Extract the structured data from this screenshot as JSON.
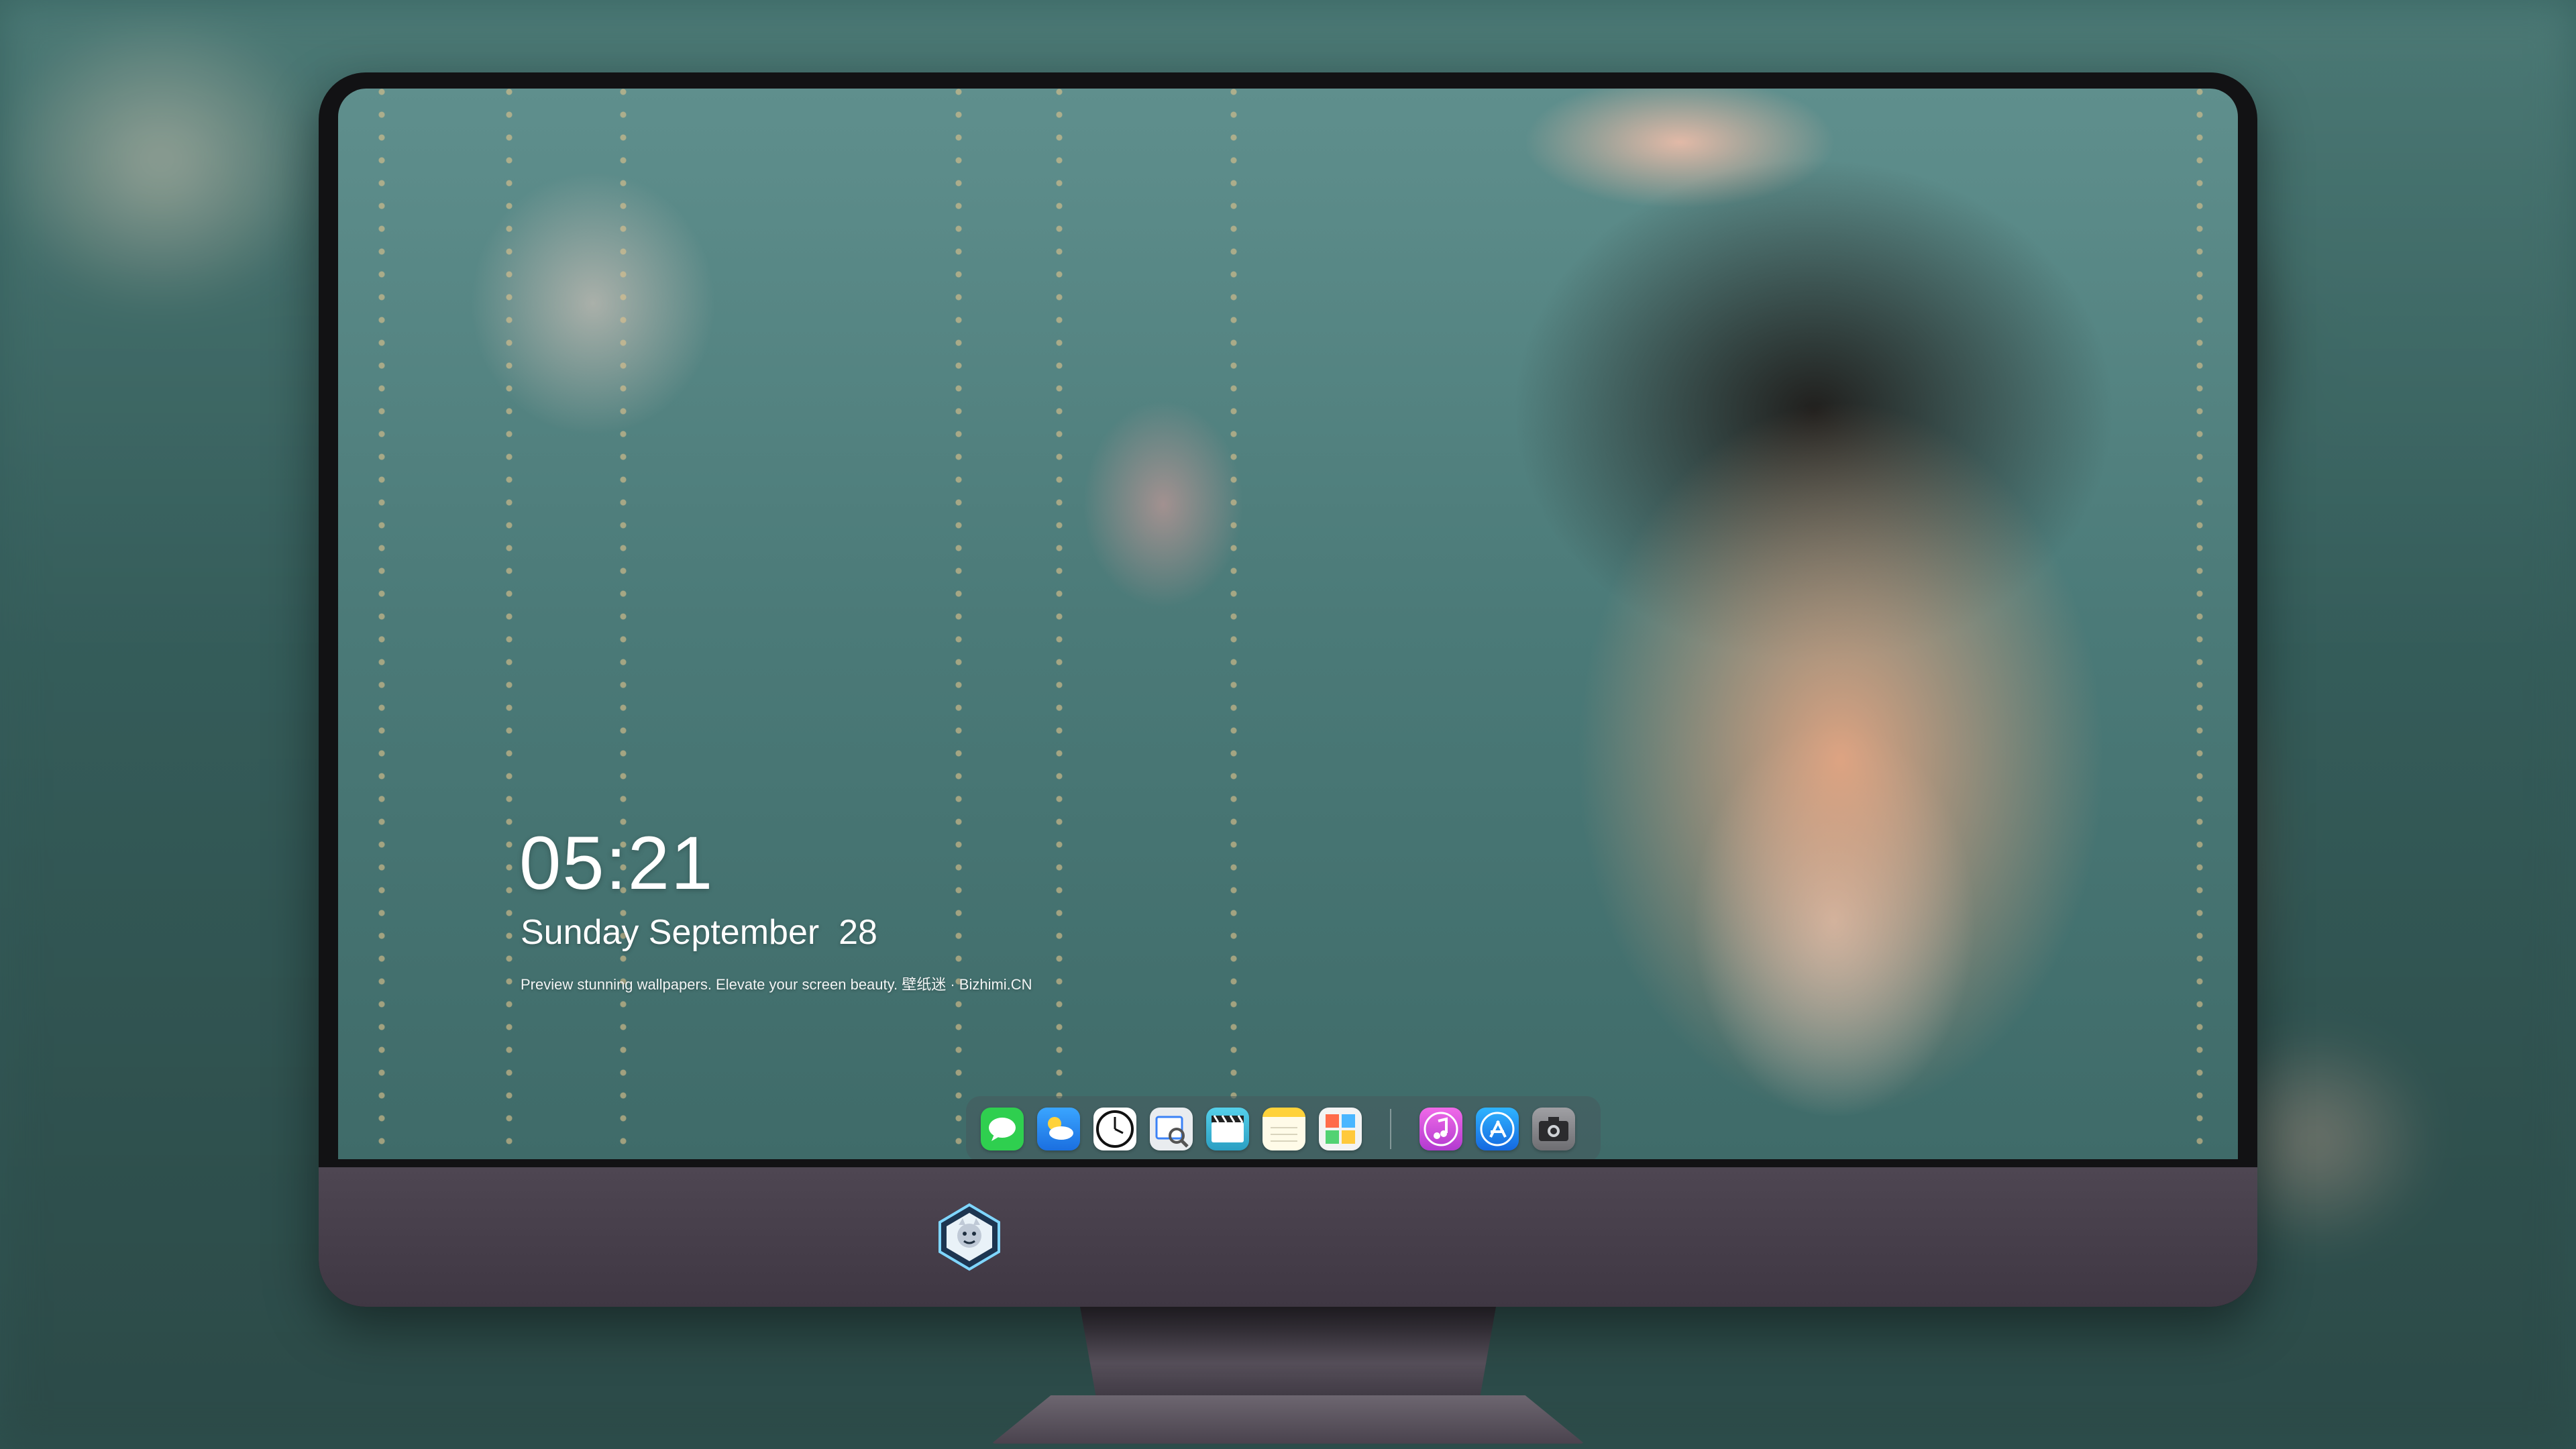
{
  "lock_screen": {
    "time": "05:21",
    "date": "Sunday September  28",
    "tagline": "Preview stunning wallpapers. Elevate your screen beauty. 壁纸迷 · Bizhimi.CN"
  },
  "dock": {
    "apps": [
      {
        "name": "messages-icon",
        "color": "#2fcf4f"
      },
      {
        "name": "weather-icon",
        "color": "#2a8cf0"
      },
      {
        "name": "clock-icon",
        "color": "#ffffff"
      },
      {
        "name": "preview-icon",
        "color": "#e9ecef"
      },
      {
        "name": "video-editor-icon",
        "color": "#36b8d8"
      },
      {
        "name": "notes-icon",
        "color": "#ffd23a"
      },
      {
        "name": "photo-booth-icon",
        "color": "#f3f3f3"
      },
      {
        "name": "music-icon",
        "color": "#d64ad8"
      },
      {
        "name": "app-store-icon",
        "color": "#1b8af2"
      },
      {
        "name": "camera-icon",
        "color": "#8a8a8e"
      }
    ]
  },
  "colors": {
    "monitor_chin": "#4a424e",
    "screen_tint": "#4b7a78",
    "dock_bg": "rgba(70,90,92,0.55)"
  }
}
